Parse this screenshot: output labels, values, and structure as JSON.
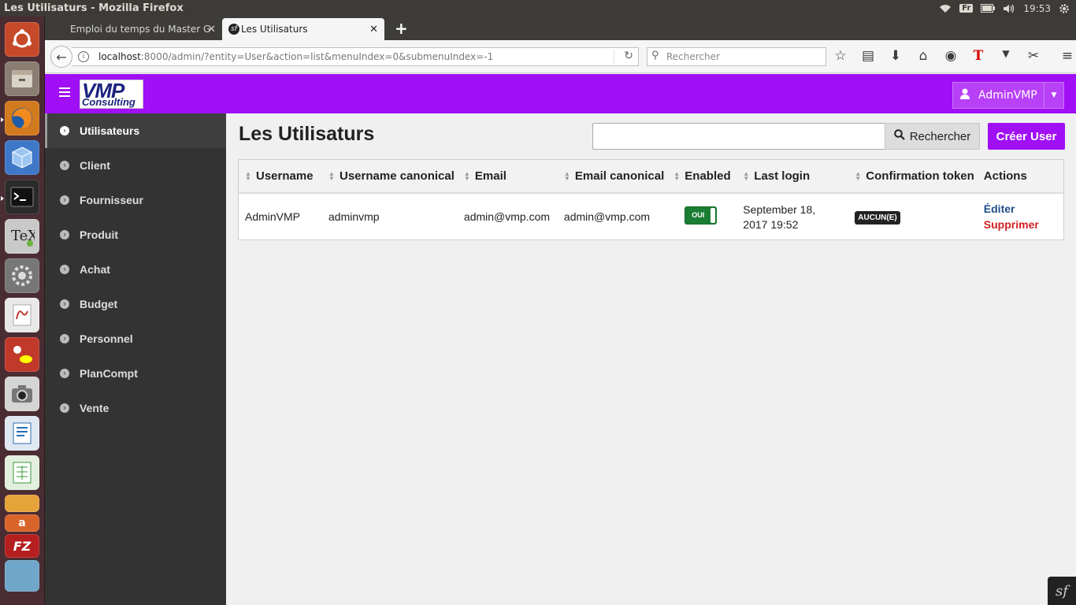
{
  "os_panel": {
    "window_title": "Les Utilisaturs - Mozilla Firefox",
    "keyboard_layout": "Fr",
    "clock": "19:53"
  },
  "launcher": {
    "apps": [
      "ubuntu-dash",
      "files",
      "firefox",
      "virtualbox",
      "terminal",
      "texmaker",
      "system-settings",
      "document-viewer",
      "draw",
      "camera",
      "writer",
      "calc",
      "impress",
      "software-center",
      "filezilla",
      "workbench"
    ]
  },
  "browser": {
    "tabs": [
      {
        "label": "Emploi du temps du Master G"
      },
      {
        "label": "Les Utilisaturs"
      }
    ],
    "url_host": "localhost",
    "url_rest": ":8000/admin/?entity=User&action=list&menuIndex=0&submenuIndex=-1",
    "search_placeholder": "Rechercher"
  },
  "header": {
    "logo_text": "VMP",
    "logo_subtext": "Consulting",
    "user_name": "AdminVMP"
  },
  "sidebar": {
    "items": [
      {
        "label": "Utilisateurs",
        "active": true
      },
      {
        "label": "Client"
      },
      {
        "label": "Fournisseur"
      },
      {
        "label": "Produit"
      },
      {
        "label": "Achat"
      },
      {
        "label": "Budget"
      },
      {
        "label": "Personnel"
      },
      {
        "label": "PlanCompt"
      },
      {
        "label": "Vente"
      }
    ]
  },
  "main": {
    "title": "Les Utilisaturs",
    "search_button": "Rechercher",
    "create_button": "Créer User",
    "columns": [
      "Username",
      "Username canonical",
      "Email",
      "Email canonical",
      "Enabled",
      "Last login",
      "Confirmation token",
      "Actions"
    ],
    "rows": [
      {
        "username": "AdminVMP",
        "username_canonical": "adminvmp",
        "email": "admin@vmp.com",
        "email_canonical": "admin@vmp.com",
        "enabled": "OUI",
        "last_login_line1": "September 18,",
        "last_login_line2": "2017 19:52",
        "confirmation_token": "AUCUN(E)",
        "action_edit": "Éditer",
        "action_delete": "Supprimer"
      }
    ]
  },
  "colors": {
    "brand_purple": "#a00ff5",
    "sidebar_bg": "#333333",
    "enabled_green": "#1b7d34",
    "delete_red": "#d22020",
    "edit_blue": "#1f4f8a"
  }
}
